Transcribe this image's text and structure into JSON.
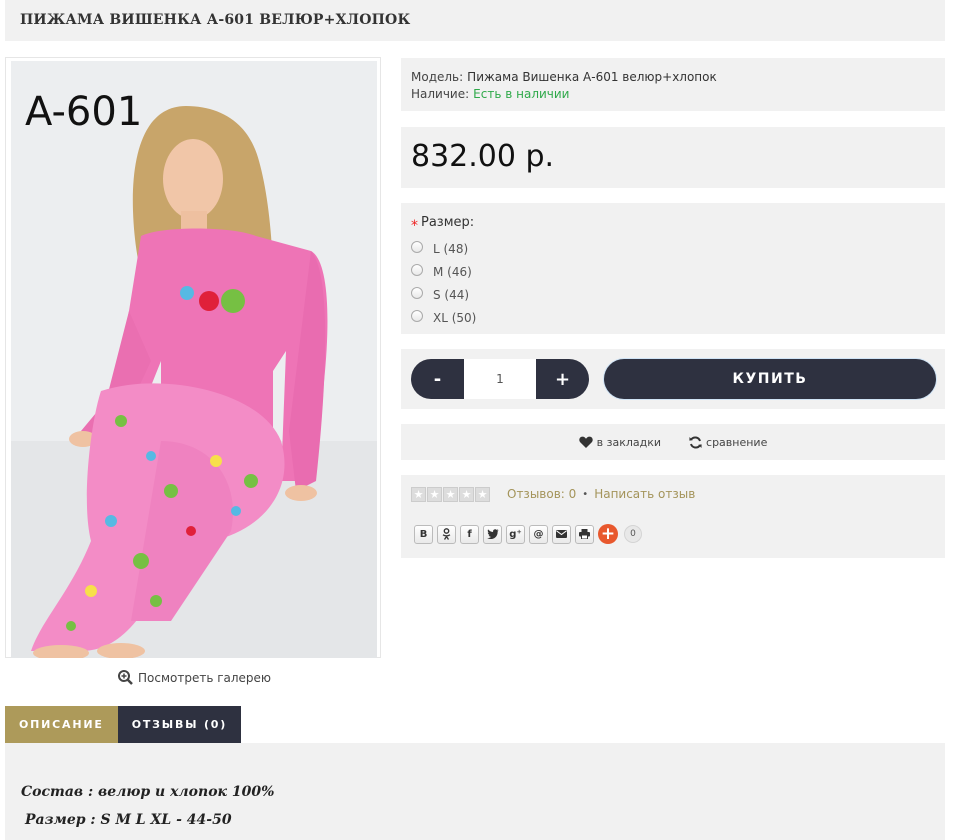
{
  "product": {
    "title": "ПИЖАМА ВИШЕНКА А-601 ВЕЛЮР+ХЛОПОК",
    "image_label": "A-601",
    "gallery_link": "Посмотреть галерею"
  },
  "info": {
    "model_label": "Модель:",
    "model_value": "Пижама Вишенка А-601 велюр+хлопок",
    "stock_label": "Наличие:",
    "stock_value": "Есть в наличии"
  },
  "price": "832.00 р.",
  "options": {
    "required_mark": "*",
    "label": "Размер:",
    "sizes": [
      "L (48)",
      "M (46)",
      "S (44)",
      "XL (50)"
    ]
  },
  "buy": {
    "minus": "-",
    "quantity": "1",
    "plus": "+",
    "buy_label": "КУПИТЬ"
  },
  "actions": {
    "wishlist": "в закладки",
    "compare": "сравнение"
  },
  "reviews": {
    "count_text": "Отзывов: 0",
    "separator": "•",
    "write_text": "Написать отзыв",
    "share_count": "0",
    "share_buttons": [
      "B",
      "ok",
      "f",
      "twitter",
      "g+",
      "@",
      "mail",
      "print"
    ]
  },
  "tabs": [
    "ОПИСАНИЕ",
    "ОТЗЫВЫ (0)"
  ],
  "description": {
    "line1": "Состав : велюр и хлопок 100%",
    "line2": "Размер : S M L XL - 44-50"
  },
  "colors": {
    "accent_gold": "#ad9a5a",
    "dark": "#2e3140",
    "in_stock": "#2fa94a",
    "panel_bg": "#f1f1f1"
  }
}
